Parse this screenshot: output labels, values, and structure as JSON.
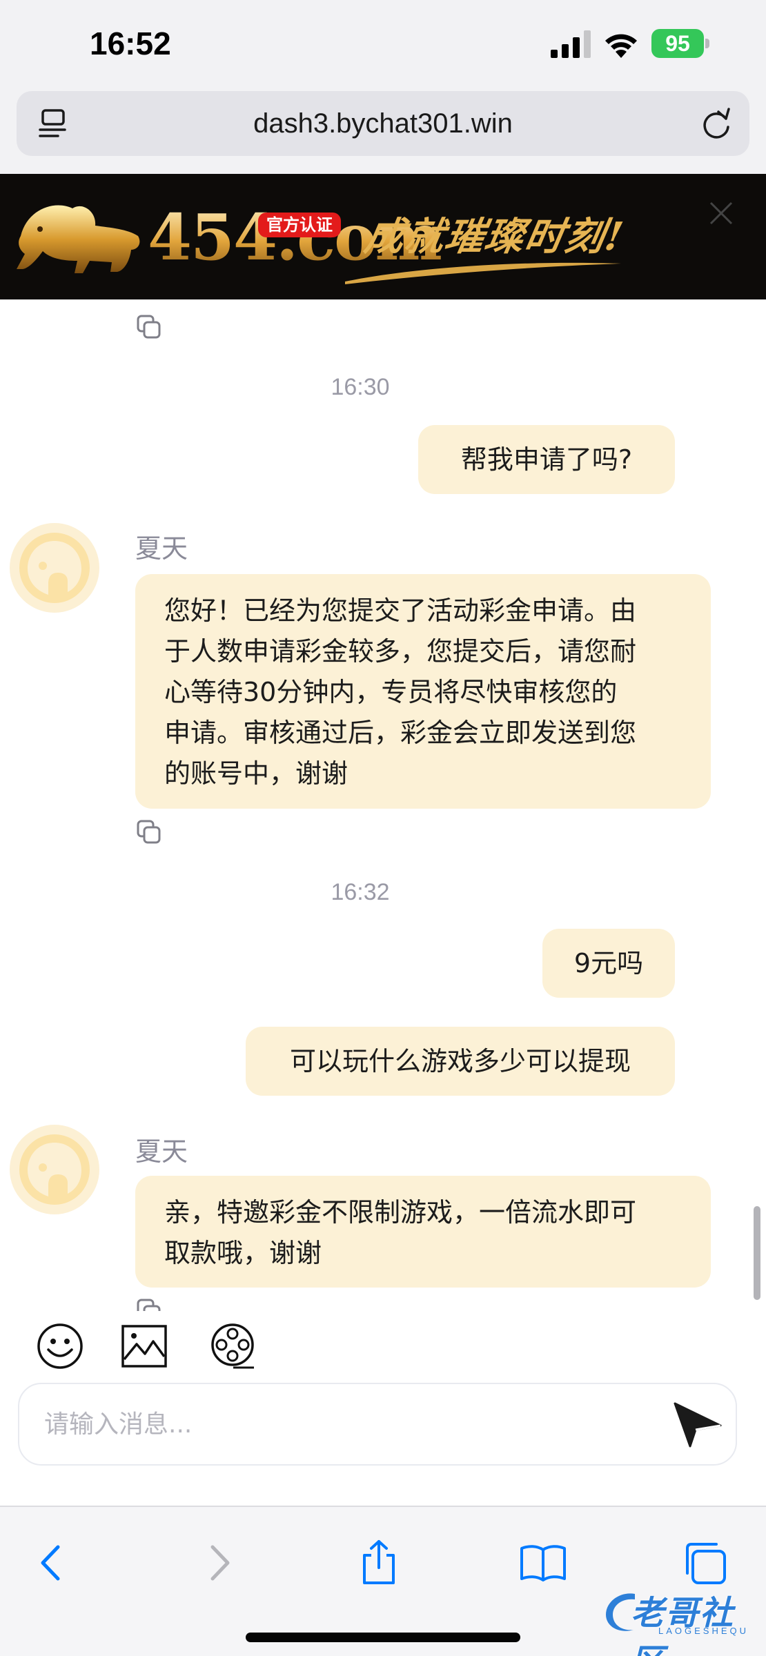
{
  "status_bar": {
    "time": "16:52",
    "battery": "95"
  },
  "browser": {
    "url": "dash3.bychat301.win"
  },
  "banner": {
    "brand": "454.com",
    "badge": "官方认证",
    "slogan": "成就璀璨时刻!"
  },
  "chat": {
    "messages": [
      {
        "type": "timestamp",
        "text": "16:30"
      },
      {
        "type": "sent",
        "text": "帮我申请了吗?"
      },
      {
        "type": "received",
        "sender": "夏天",
        "lines": [
          "您好！已经为您提交了活动彩金申请。由",
          "于人数申请彩金较多，您提交后，请您耐",
          "心等待30分钟内，专员将尽快审核您的",
          "申请。审核通过后，彩金会立即发送到您",
          "的账号中，谢谢"
        ]
      },
      {
        "type": "timestamp",
        "text": "16:32"
      },
      {
        "type": "sent",
        "text": "9元吗"
      },
      {
        "type": "sent",
        "text": "可以玩什么游戏多少可以提现"
      },
      {
        "type": "received",
        "sender": "夏天",
        "lines": [
          "亲，特邀彩金不限制游戏，一倍流水即可",
          "取款哦，谢谢"
        ]
      }
    ]
  },
  "composer": {
    "placeholder": "请输入消息..."
  },
  "tools": [
    "emoji-icon",
    "image-icon",
    "video-icon"
  ],
  "watermark": {
    "text": "老哥社区",
    "sub": "LAOGESHEQU"
  },
  "colors": {
    "bubble": "#fcf1d6",
    "accent": "#007aff",
    "timestamp": "#9a9aa6"
  }
}
